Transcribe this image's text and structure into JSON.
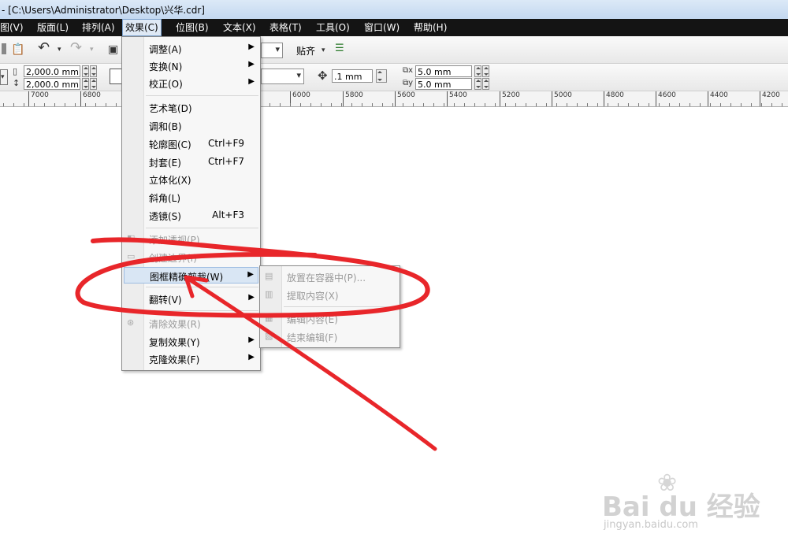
{
  "window": {
    "title": "- [C:\\Users\\Administrator\\Desktop\\兴华.cdr]"
  },
  "menubar": [
    {
      "label": "图(V)"
    },
    {
      "label": "版面(L)"
    },
    {
      "label": "排列(A)"
    },
    {
      "label": "效果(C)",
      "active": true
    },
    {
      "label": "位图(B)"
    },
    {
      "label": "文本(X)"
    },
    {
      "label": "表格(T)"
    },
    {
      "label": "工具(O)"
    },
    {
      "label": "窗口(W)"
    },
    {
      "label": "帮助(H)"
    }
  ],
  "toolbar": {
    "snap_label": "贴齐",
    "width_value": "2,000.0 mm",
    "height_value": "2,000.0 mm",
    "nudge_value": ".1 mm",
    "dup_x_value": "5.0 mm",
    "dup_y_value": "5.0 mm"
  },
  "ruler": {
    "ticks": [
      "7000",
      "6800",
      "6000",
      "5800",
      "5600",
      "5400",
      "5200",
      "5000",
      "4800",
      "4600",
      "4400",
      "4200"
    ]
  },
  "effects_menu": {
    "items": [
      {
        "label": "调整(A)",
        "submenu": true
      },
      {
        "label": "变换(N)",
        "submenu": true
      },
      {
        "label": "校正(O)",
        "submenu": true
      },
      {
        "label": "艺术笔(D)"
      },
      {
        "label": "调和(B)"
      },
      {
        "label": "轮廓图(C)",
        "shortcut": "Ctrl+F9"
      },
      {
        "label": "封套(E)",
        "shortcut": "Ctrl+F7"
      },
      {
        "label": "立体化(X)"
      },
      {
        "label": "斜角(L)"
      },
      {
        "label": "透镜(S)",
        "shortcut": "Alt+F3"
      },
      {
        "label": "添加透视(P)",
        "disabled": true
      },
      {
        "label": "创建边界(I)",
        "disabled": true
      },
      {
        "label": "图框精确剪裁(W)",
        "submenu": true,
        "highlighted": true
      },
      {
        "label": "翻转(V)",
        "submenu": true
      },
      {
        "label": "清除效果(R)",
        "disabled": true
      },
      {
        "label": "复制效果(Y)",
        "submenu": true
      },
      {
        "label": "克隆效果(F)",
        "submenu": true
      }
    ]
  },
  "powerclip_submenu": {
    "items": [
      {
        "label": "放置在容器中(P)...",
        "disabled": true
      },
      {
        "label": "提取内容(X)",
        "disabled": true
      },
      {
        "label": "编辑内容(E)",
        "disabled": true
      },
      {
        "label": "结束编辑(F)",
        "disabled": true
      }
    ]
  },
  "watermark": {
    "brand": "Bai du 经验",
    "url": "jingyan.baidu.com"
  },
  "annotation": {
    "color": "#e8262a"
  }
}
